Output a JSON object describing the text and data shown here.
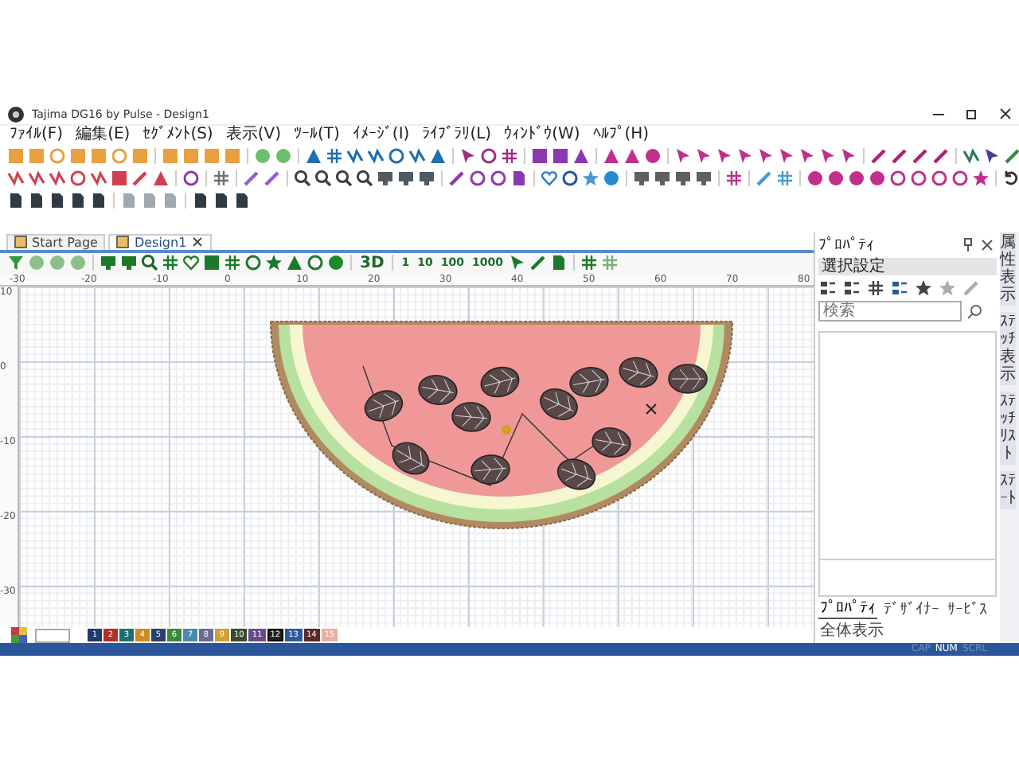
{
  "window": {
    "title": "Tajima DG16 by Pulse - Design1"
  },
  "menu": [
    "ﾌｧｲﾙ(F)",
    "編集(E)",
    "ｾｸﾞﾒﾝﾄ(S)",
    "表示(V)",
    "ﾂｰﾙ(T)",
    "ｲﾒｰｼﾞ(I)",
    "ﾗｲﾌﾞﾗﾘ(L)",
    "ｳｨﾝﾄﾞｳ(W)",
    "ﾍﾙﾌﾟ(H)"
  ],
  "doc_tabs": [
    {
      "label": "Start Page",
      "selected": false
    },
    {
      "label": "Design1",
      "selected": true
    }
  ],
  "design_toolbar": {
    "step_buttons": [
      "1",
      "10",
      "100",
      "1000"
    ],
    "view_3d": "3D"
  },
  "ruler": {
    "x_labels": [
      "-30",
      "-20",
      "-10",
      "0",
      "10",
      "20",
      "30",
      "40",
      "50",
      "60",
      "70",
      "80"
    ],
    "y_labels": [
      "10",
      "0",
      "-10",
      "-20",
      "-30"
    ]
  },
  "palette": [
    {
      "label": "1",
      "color": "#1f3a70",
      "selected": false
    },
    {
      "label": "2",
      "color": "#b0302a",
      "selected": false
    },
    {
      "label": "3",
      "color": "#1f6f70",
      "selected": false
    },
    {
      "label": "4",
      "color": "#d08a20",
      "selected": false
    },
    {
      "label": "5",
      "color": "#2a3f6a",
      "selected": false
    },
    {
      "label": "6",
      "color": "#3a8a3a",
      "selected": false
    },
    {
      "label": "7",
      "color": "#4a8ab0",
      "selected": false
    },
    {
      "label": "8",
      "color": "#6a6a9a",
      "selected": false
    },
    {
      "label": "9",
      "color": "#d0a030",
      "selected": false
    },
    {
      "label": "10",
      "color": "#3a4a2a",
      "selected": false
    },
    {
      "label": "11",
      "color": "#6a4a8a",
      "selected": false
    },
    {
      "label": "12",
      "color": "#202020",
      "selected": true
    },
    {
      "label": "13",
      "color": "#2a5aa0",
      "selected": false
    },
    {
      "label": "14",
      "color": "#5a2a2a",
      "selected": false
    },
    {
      "label": "15",
      "color": "#e8b0a0",
      "selected": false
    }
  ],
  "properties": {
    "title": "ﾌﾟﾛﾊﾟﾃｨ",
    "dropdown": "選択設定",
    "search": {
      "placeholder": "検索"
    },
    "bottom_tabs": [
      {
        "label": "ﾌﾟﾛﾊﾟﾃｨ",
        "selected": true
      },
      {
        "label": "ﾃﾞｻﾞｲﾅｰ",
        "selected": false
      },
      {
        "label": "ｻｰﾋﾞｽ",
        "selected": false
      },
      {
        "label": "全体表示",
        "selected": false
      }
    ]
  },
  "side_tabs": [
    "属性表示",
    "ｽﾃｯﾁ表示",
    "ｽﾃｯﾁﾘｽﾄ",
    "ｽﾃｰﾄ"
  ],
  "status_bar": [
    {
      "label": "CAP",
      "on": false
    },
    {
      "label": "NUM",
      "on": true
    },
    {
      "label": "SCRL",
      "on": false
    }
  ]
}
